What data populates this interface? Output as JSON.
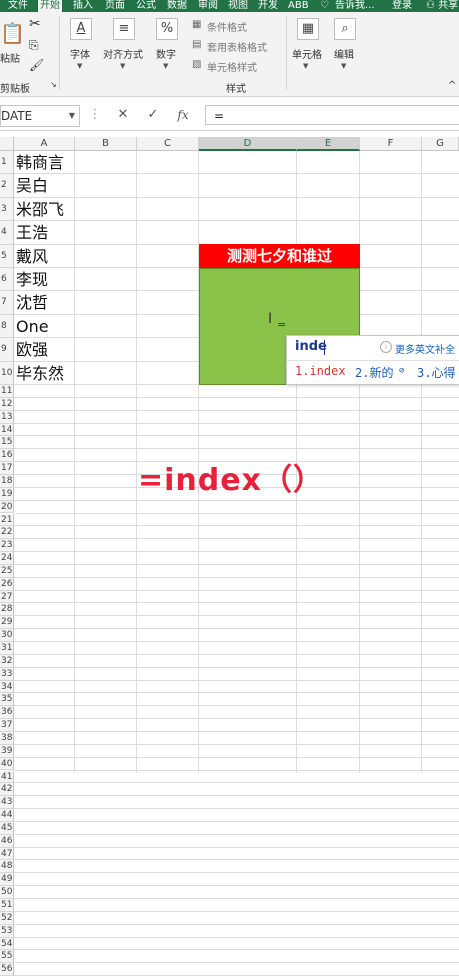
{
  "tabs": [
    "文件",
    "开始",
    "插入",
    "页面",
    "公式",
    "数据",
    "审阅",
    "视图",
    "开发",
    "ABB"
  ],
  "tell_me": "告诉我...",
  "login": "登录",
  "share": "共享",
  "ribbon": {
    "paste": "粘贴",
    "clipboard_group": "剪贴板",
    "font": "字体",
    "alignment": "对齐方式",
    "number": "数字",
    "conditional_format": "条件格式",
    "table_format": "套用表格格式",
    "cell_style": "单元格样式",
    "styles_group": "样式",
    "cells": "单元格",
    "editing": "编辑"
  },
  "formula_bar": {
    "name_box": "DATE",
    "fx": "fx",
    "content": "="
  },
  "columns": [
    "A",
    "B",
    "C",
    "D",
    "E",
    "F",
    "G"
  ],
  "rows": [
    "1",
    "2",
    "3",
    "4",
    "5",
    "6",
    "7",
    "8",
    "9",
    "10",
    "11",
    "12",
    "13",
    "14",
    "15",
    "16",
    "17",
    "18",
    "19",
    "20",
    "21",
    "22",
    "23",
    "24",
    "25",
    "26",
    "27",
    "28",
    "29",
    "30",
    "31",
    "32",
    "33",
    "34",
    "35",
    "36",
    "37",
    "38",
    "39",
    "40",
    "41",
    "42",
    "43",
    "44",
    "45",
    "46",
    "47",
    "48",
    "49",
    "50",
    "51",
    "52",
    "53",
    "54",
    "55",
    "56"
  ],
  "names": [
    "韩商言",
    "吴白",
    "米邵飞",
    "王浩",
    "戴风",
    "李现",
    "沈哲",
    "One",
    "欧强",
    "毕东然"
  ],
  "red_title": "测测七夕和谁过",
  "cell_text": "=",
  "ime": {
    "input": "inde",
    "hint": "更多英文补全",
    "candidates": [
      "1.index",
      "2.新的",
      "3.心得"
    ]
  },
  "big_formula": "=index（）",
  "colors": {
    "ribbon_green": "#217346",
    "title_red": "#ff0000",
    "block_green": "#8bc34a",
    "formula_red": "#e8213a"
  }
}
